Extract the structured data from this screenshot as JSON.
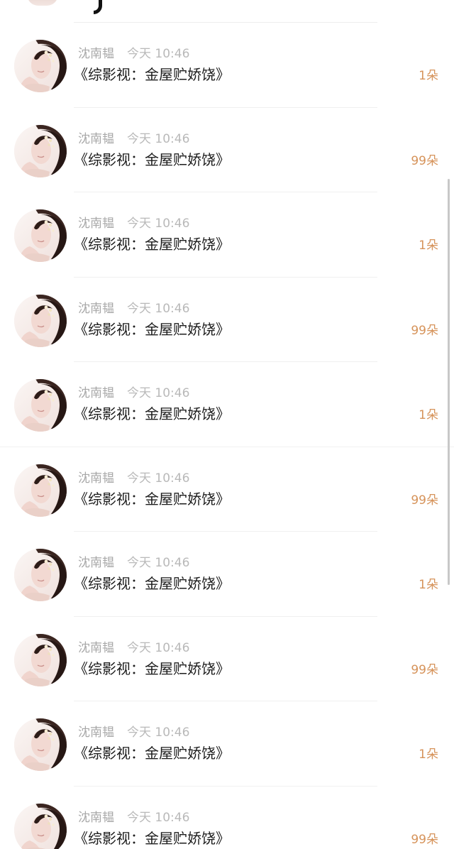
{
  "gift_list": {
    "items": [
      {
        "sender": "沈南韫",
        "time": "今天 10:46",
        "title": "《综影视：金屋贮娇饶》",
        "amount": "1朵"
      },
      {
        "sender": "沈南韫",
        "time": "今天 10:46",
        "title": "《综影视：金屋贮娇饶》",
        "amount": "99朵"
      },
      {
        "sender": "沈南韫",
        "time": "今天 10:46",
        "title": "《综影视：金屋贮娇饶》",
        "amount": "1朵"
      },
      {
        "sender": "沈南韫",
        "time": "今天 10:46",
        "title": "《综影视：金屋贮娇饶》",
        "amount": "99朵"
      },
      {
        "sender": "沈南韫",
        "time": "今天 10:46",
        "title": "《综影视：金屋贮娇饶》",
        "amount": "1朵"
      },
      {
        "sender": "沈南韫",
        "time": "今天 10:46",
        "title": "《综影视：金屋贮娇饶》",
        "amount": "99朵"
      },
      {
        "sender": "沈南韫",
        "time": "今天 10:46",
        "title": "《综影视：金屋贮娇饶》",
        "amount": "1朵"
      },
      {
        "sender": "沈南韫",
        "time": "今天 10:46",
        "title": "《综影视：金屋贮娇饶》",
        "amount": "99朵"
      },
      {
        "sender": "沈南韫",
        "time": "今天 10:46",
        "title": "《综影视：金屋贮娇饶》",
        "amount": "1朵"
      },
      {
        "sender": "沈南韫",
        "time": "今天 10:46",
        "title": "《综影视：金屋贮娇饶》",
        "amount": "99朵"
      }
    ]
  },
  "icons": {
    "avatar": "user-avatar-photo-icon",
    "scrollbar": "vertical-scrollbar"
  },
  "colors": {
    "amount": "#d6935a",
    "title": "#1c1c1c",
    "meta": "#a8a8a8",
    "divider": "#f0f0f0"
  }
}
